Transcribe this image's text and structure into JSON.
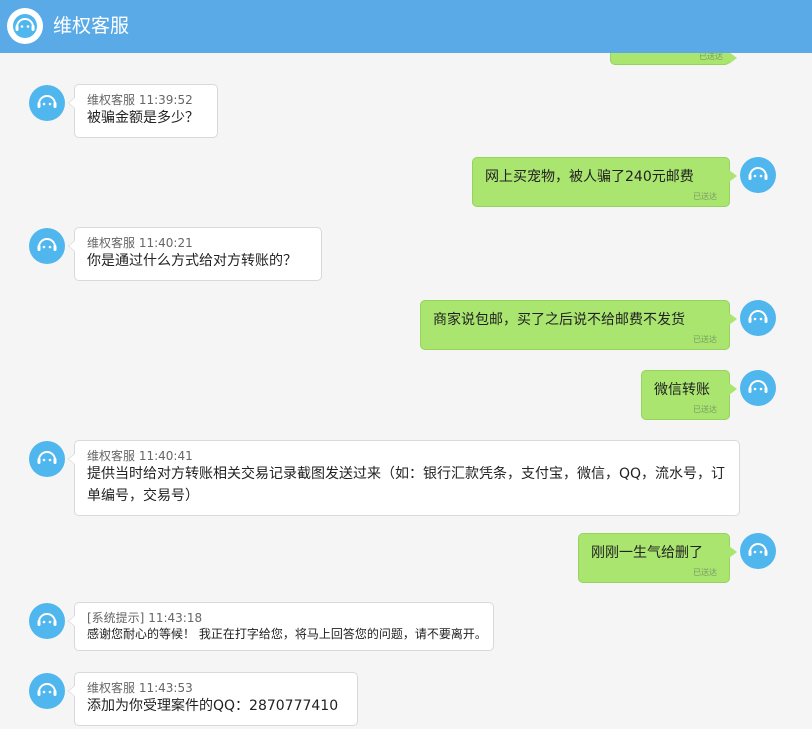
{
  "header": {
    "title": "维权客服"
  },
  "icons": {
    "agent_avatar": "headset-smiley-icon"
  },
  "colors": {
    "header": "#5aaae8",
    "bubble_out": "#a9e56f",
    "avatar": "#4fb6ee"
  },
  "messages": [
    {
      "side": "out",
      "text": "",
      "status": "已送达"
    },
    {
      "side": "in",
      "sender": "维权客服",
      "time": "11:39:52",
      "text": "被骗金额是多少？"
    },
    {
      "side": "out",
      "text": "网上买宠物，被人骗了240元邮费",
      "status": "已送达"
    },
    {
      "side": "in",
      "sender": "维权客服",
      "time": "11:40:21",
      "text": "你是通过什么方式给对方转账的？"
    },
    {
      "side": "out",
      "text": "商家说包邮，买了之后说不给邮费不发货",
      "status": "已送达"
    },
    {
      "side": "out",
      "text": "微信转账",
      "status": "已送达"
    },
    {
      "side": "in",
      "sender": "维权客服",
      "time": "11:40:41",
      "text": "提供当时给对方转账相关交易记录截图发送过来（如：银行汇款凭条，支付宝，微信，QQ，流水号，订单编号，交易号）"
    },
    {
      "side": "out",
      "text": "刚刚一生气给删了",
      "status": "已送达"
    },
    {
      "side": "in",
      "sender": "[系统提示]",
      "time": "11:43:18",
      "text": "感谢您耐心的等候！ 我正在打字给您，将马上回答您的问题，请不要离开。"
    },
    {
      "side": "in",
      "sender": "维权客服",
      "time": "11:43:53",
      "text": "添加为你受理案件的QQ：2870777410"
    }
  ]
}
